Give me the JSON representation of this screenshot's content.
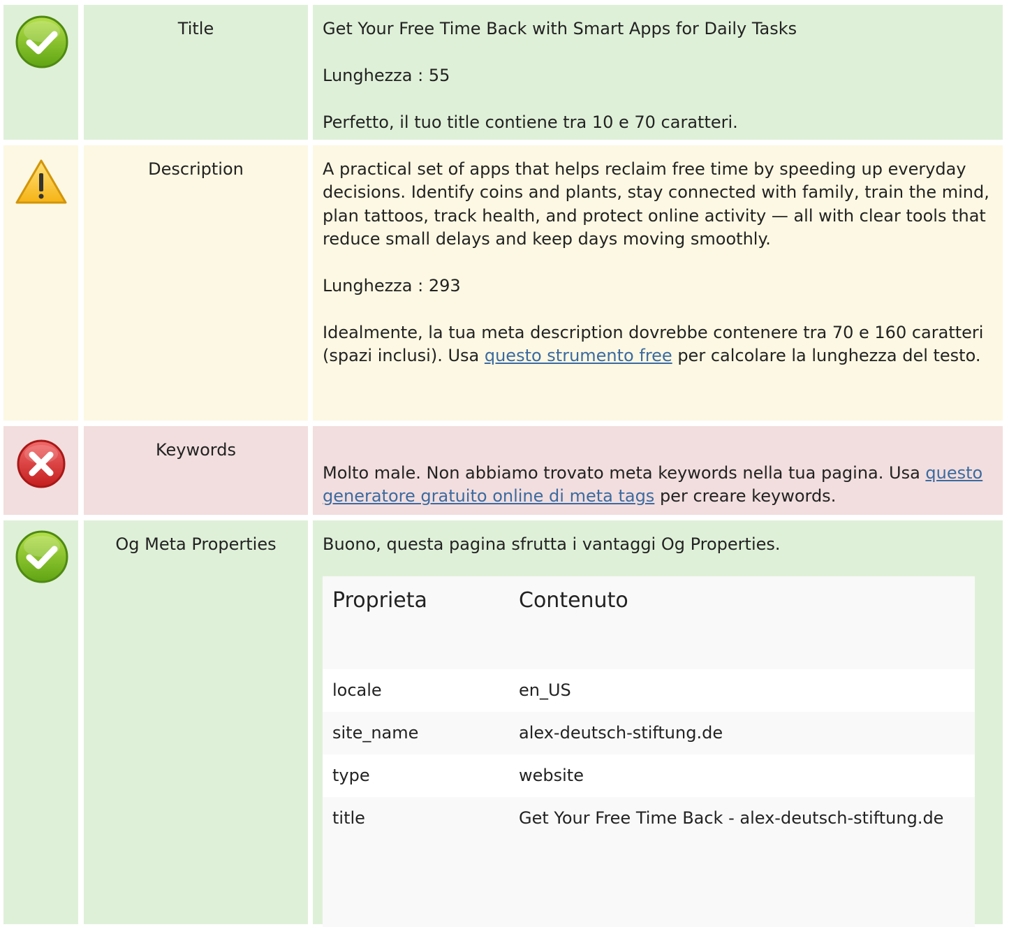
{
  "rows": {
    "title": {
      "label": "Title",
      "status": "ok",
      "text": "Get Your Free Time Back with Smart Apps for Daily Tasks",
      "length": "Lunghezza : 55",
      "note": "Perfetto, il tuo title contiene tra 10 e 70 caratteri."
    },
    "description": {
      "label": "Description",
      "status": "warning",
      "text": "A practical set of apps that helps reclaim free time by speeding up everyday decisions. Identify coins and plants, stay connected with family, train the mind, plan tattoos, track health, and protect online activity — all with clear tools that reduce small delays and keep days moving smoothly.",
      "length": "Lunghezza : 293",
      "note_before": "Idealmente, la tua meta description dovrebbe contenere tra 70 e 160 caratteri (spazi inclusi). Usa ",
      "note_link": "questo strumento free",
      "note_after": " per calcolare la lunghezza del testo."
    },
    "keywords": {
      "label": "Keywords",
      "status": "error",
      "note_before": "Molto male. Non abbiamo trovato meta keywords nella tua pagina. Usa ",
      "note_link": "questo generatore gratuito online di meta tags",
      "note_after": " per creare keywords."
    },
    "og": {
      "label": "Og Meta Properties",
      "status": "ok",
      "note": "Buono, questa pagina sfrutta i vantaggi Og Properties.",
      "table": {
        "headers": [
          "Proprieta",
          "Contenuto"
        ],
        "rows": [
          {
            "key": "locale",
            "value": "en_US"
          },
          {
            "key": "site_name",
            "value": "alex-deutsch-stiftung.de"
          },
          {
            "key": "type",
            "value": "website"
          },
          {
            "key": "title",
            "value": "Get Your Free Time Back - alex-deutsch-stiftung.de"
          }
        ]
      }
    }
  },
  "colors": {
    "ok_bg": "#dff0d8",
    "warning_bg": "#fcf8e3",
    "error_bg": "#f2dede",
    "link": "#3b6aa0"
  },
  "icons": {
    "ok": "check-circle-icon",
    "warning": "warning-triangle-icon",
    "error": "error-x-circle-icon"
  }
}
